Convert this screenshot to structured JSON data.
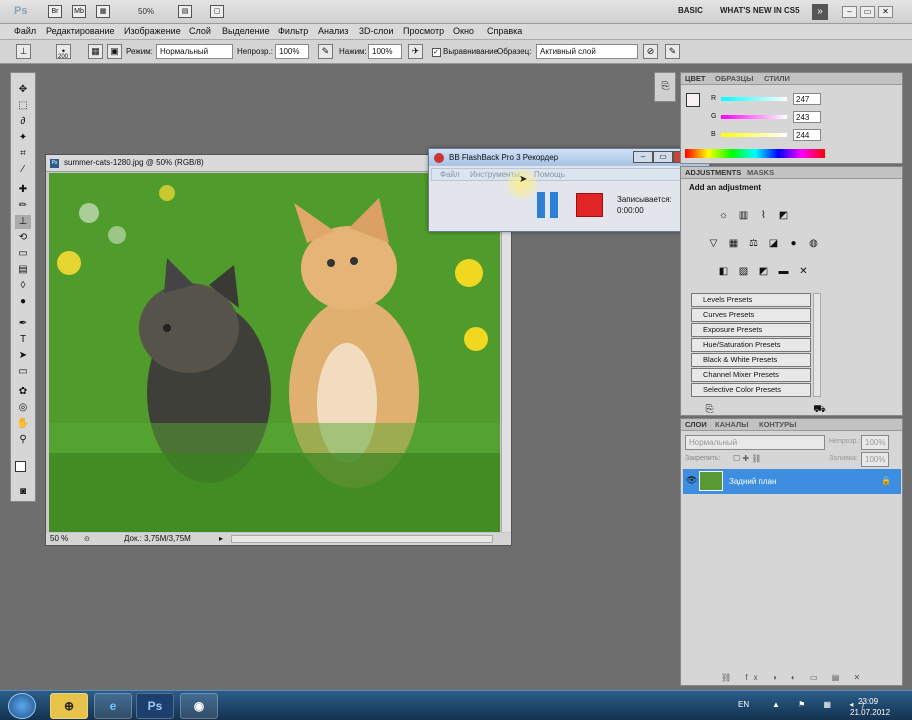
{
  "appbar": {
    "logo": "Ps",
    "zoom": "50%",
    "workspace_basic": "BASIC",
    "whats_new": "WHAT'S NEW IN CS5",
    "expand": "»"
  },
  "menubar": [
    "Файл",
    "Редактирование",
    "Изображение",
    "Слой",
    "Выделение",
    "Фильтр",
    "Анализ",
    "3D-слои",
    "Просмотр",
    "Окно",
    "Справка"
  ],
  "options": {
    "brush_size": "200",
    "mode_label": "Режим:",
    "mode_value": "Нормальный",
    "opacity_label": "Непрозр.:",
    "opacity_value": "100%",
    "pressure_label": "Нажим:",
    "pressure_value": "100%",
    "align_label": "Выравнивание",
    "sample_label": "Образец:",
    "sample_value": "Активный слой"
  },
  "document": {
    "title": "summer-cats-1280.jpg @ 50% (RGB/8)",
    "zoom": "50 %",
    "info": "Док.: 3,75M/3,75M"
  },
  "recorder": {
    "title": "BB FlashBack Pro 3 Рекордер",
    "menu_file": "Файл",
    "menu_tools": "Инструменты",
    "menu_help": "Помощь",
    "status": "Записывается:",
    "time": "0:00:00"
  },
  "color_panel": {
    "tabs": [
      "ЦВЕТ",
      "ОБРАЗЦЫ",
      "СТИЛИ"
    ],
    "r_label": "R",
    "r": "247",
    "g_label": "G",
    "g": "243",
    "b_label": "B",
    "b": "244"
  },
  "adjust_panel": {
    "tabs": [
      "ADJUSTMENTS",
      "MASKS"
    ],
    "heading": "Add an adjustment",
    "presets": [
      "Levels Presets",
      "Curves Presets",
      "Exposure Presets",
      "Hue/Saturation Presets",
      "Black & White Presets",
      "Channel Mixer Presets",
      "Selective Color Presets"
    ]
  },
  "layers_panel": {
    "tabs": [
      "СЛОИ",
      "КАНАЛЫ",
      "КОНТУРЫ"
    ],
    "blend": "Нормальный",
    "opacity_label": "Непрозр.:",
    "opacity": "100%",
    "lock_label": "Закрепить:",
    "fill_label": "Заливка:",
    "fill": "100%",
    "layer_name": "Задний план"
  },
  "taskbar": {
    "lang": "EN",
    "time": "23:09",
    "date": "21.07.2012",
    "ps": "Ps"
  }
}
